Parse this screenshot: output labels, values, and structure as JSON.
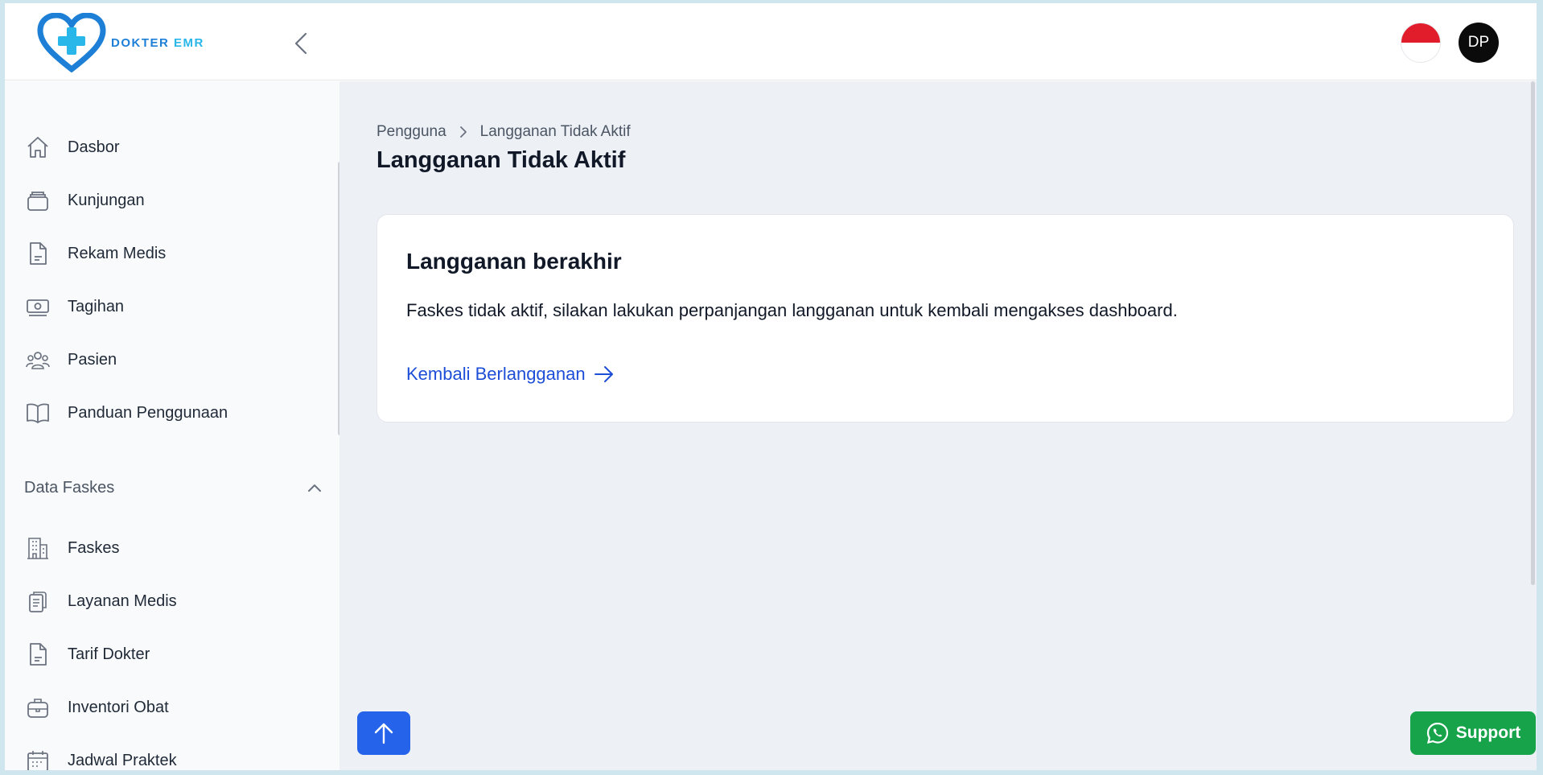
{
  "header": {
    "logo_text_main": "DOKTER",
    "logo_text_accent": "EMR",
    "user_initials": "DP",
    "language_flag": "indonesia-flag-icon"
  },
  "sidebar": {
    "items": [
      {
        "label": "Dasbor",
        "icon": "home-icon"
      },
      {
        "label": "Kunjungan",
        "icon": "inbox-icon"
      },
      {
        "label": "Rekam Medis",
        "icon": "document-icon"
      },
      {
        "label": "Tagihan",
        "icon": "cash-icon"
      },
      {
        "label": "Pasien",
        "icon": "users-icon"
      },
      {
        "label": "Panduan Penggunaan",
        "icon": "book-icon"
      }
    ],
    "section": {
      "label": "Data Faskes",
      "expanded": true,
      "items": [
        {
          "label": "Faskes",
          "icon": "building-icon"
        },
        {
          "label": "Layanan Medis",
          "icon": "clipboard-icon"
        },
        {
          "label": "Tarif Dokter",
          "icon": "document-icon"
        },
        {
          "label": "Inventori Obat",
          "icon": "briefcase-icon"
        },
        {
          "label": "Jadwal Praktek",
          "icon": "calendar-icon"
        }
      ]
    }
  },
  "main": {
    "breadcrumb": [
      "Pengguna",
      "Langganan Tidak Aktif"
    ],
    "title": "Langganan Tidak Aktif",
    "card": {
      "title": "Langganan berakhir",
      "message": "Faskes tidak aktif, silakan lakukan perpanjangan langganan untuk kembali mengakses dashboard.",
      "link_label": "Kembali Berlangganan"
    },
    "support_label": "Support"
  },
  "colors": {
    "brand_blue": "#1d7fd6",
    "link_blue": "#1d4ed8",
    "primary_button": "#2563eb",
    "support_green": "#16a34a",
    "main_bg": "#edf1f6",
    "sidebar_bg": "#f9fafb"
  }
}
